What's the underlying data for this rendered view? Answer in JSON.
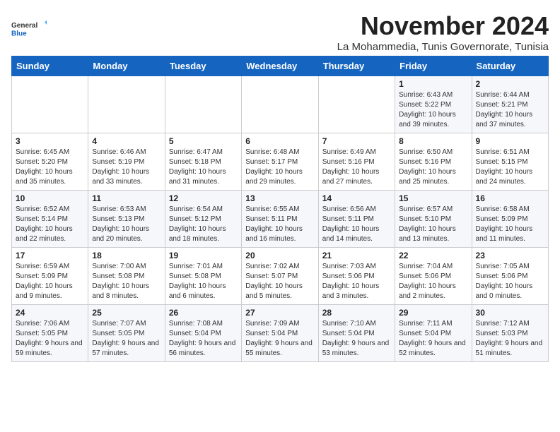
{
  "logo": {
    "general": "General",
    "blue": "Blue"
  },
  "header": {
    "month": "November 2024",
    "location": "La Mohammedia, Tunis Governorate, Tunisia"
  },
  "weekdays": [
    "Sunday",
    "Monday",
    "Tuesday",
    "Wednesday",
    "Thursday",
    "Friday",
    "Saturday"
  ],
  "weeks": [
    [
      {
        "day": "",
        "info": ""
      },
      {
        "day": "",
        "info": ""
      },
      {
        "day": "",
        "info": ""
      },
      {
        "day": "",
        "info": ""
      },
      {
        "day": "",
        "info": ""
      },
      {
        "day": "1",
        "info": "Sunrise: 6:43 AM\nSunset: 5:22 PM\nDaylight: 10 hours and 39 minutes."
      },
      {
        "day": "2",
        "info": "Sunrise: 6:44 AM\nSunset: 5:21 PM\nDaylight: 10 hours and 37 minutes."
      }
    ],
    [
      {
        "day": "3",
        "info": "Sunrise: 6:45 AM\nSunset: 5:20 PM\nDaylight: 10 hours and 35 minutes."
      },
      {
        "day": "4",
        "info": "Sunrise: 6:46 AM\nSunset: 5:19 PM\nDaylight: 10 hours and 33 minutes."
      },
      {
        "day": "5",
        "info": "Sunrise: 6:47 AM\nSunset: 5:18 PM\nDaylight: 10 hours and 31 minutes."
      },
      {
        "day": "6",
        "info": "Sunrise: 6:48 AM\nSunset: 5:17 PM\nDaylight: 10 hours and 29 minutes."
      },
      {
        "day": "7",
        "info": "Sunrise: 6:49 AM\nSunset: 5:16 PM\nDaylight: 10 hours and 27 minutes."
      },
      {
        "day": "8",
        "info": "Sunrise: 6:50 AM\nSunset: 5:16 PM\nDaylight: 10 hours and 25 minutes."
      },
      {
        "day": "9",
        "info": "Sunrise: 6:51 AM\nSunset: 5:15 PM\nDaylight: 10 hours and 24 minutes."
      }
    ],
    [
      {
        "day": "10",
        "info": "Sunrise: 6:52 AM\nSunset: 5:14 PM\nDaylight: 10 hours and 22 minutes."
      },
      {
        "day": "11",
        "info": "Sunrise: 6:53 AM\nSunset: 5:13 PM\nDaylight: 10 hours and 20 minutes."
      },
      {
        "day": "12",
        "info": "Sunrise: 6:54 AM\nSunset: 5:12 PM\nDaylight: 10 hours and 18 minutes."
      },
      {
        "day": "13",
        "info": "Sunrise: 6:55 AM\nSunset: 5:11 PM\nDaylight: 10 hours and 16 minutes."
      },
      {
        "day": "14",
        "info": "Sunrise: 6:56 AM\nSunset: 5:11 PM\nDaylight: 10 hours and 14 minutes."
      },
      {
        "day": "15",
        "info": "Sunrise: 6:57 AM\nSunset: 5:10 PM\nDaylight: 10 hours and 13 minutes."
      },
      {
        "day": "16",
        "info": "Sunrise: 6:58 AM\nSunset: 5:09 PM\nDaylight: 10 hours and 11 minutes."
      }
    ],
    [
      {
        "day": "17",
        "info": "Sunrise: 6:59 AM\nSunset: 5:09 PM\nDaylight: 10 hours and 9 minutes."
      },
      {
        "day": "18",
        "info": "Sunrise: 7:00 AM\nSunset: 5:08 PM\nDaylight: 10 hours and 8 minutes."
      },
      {
        "day": "19",
        "info": "Sunrise: 7:01 AM\nSunset: 5:08 PM\nDaylight: 10 hours and 6 minutes."
      },
      {
        "day": "20",
        "info": "Sunrise: 7:02 AM\nSunset: 5:07 PM\nDaylight: 10 hours and 5 minutes."
      },
      {
        "day": "21",
        "info": "Sunrise: 7:03 AM\nSunset: 5:06 PM\nDaylight: 10 hours and 3 minutes."
      },
      {
        "day": "22",
        "info": "Sunrise: 7:04 AM\nSunset: 5:06 PM\nDaylight: 10 hours and 2 minutes."
      },
      {
        "day": "23",
        "info": "Sunrise: 7:05 AM\nSunset: 5:06 PM\nDaylight: 10 hours and 0 minutes."
      }
    ],
    [
      {
        "day": "24",
        "info": "Sunrise: 7:06 AM\nSunset: 5:05 PM\nDaylight: 9 hours and 59 minutes."
      },
      {
        "day": "25",
        "info": "Sunrise: 7:07 AM\nSunset: 5:05 PM\nDaylight: 9 hours and 57 minutes."
      },
      {
        "day": "26",
        "info": "Sunrise: 7:08 AM\nSunset: 5:04 PM\nDaylight: 9 hours and 56 minutes."
      },
      {
        "day": "27",
        "info": "Sunrise: 7:09 AM\nSunset: 5:04 PM\nDaylight: 9 hours and 55 minutes."
      },
      {
        "day": "28",
        "info": "Sunrise: 7:10 AM\nSunset: 5:04 PM\nDaylight: 9 hours and 53 minutes."
      },
      {
        "day": "29",
        "info": "Sunrise: 7:11 AM\nSunset: 5:04 PM\nDaylight: 9 hours and 52 minutes."
      },
      {
        "day": "30",
        "info": "Sunrise: 7:12 AM\nSunset: 5:03 PM\nDaylight: 9 hours and 51 minutes."
      }
    ]
  ]
}
